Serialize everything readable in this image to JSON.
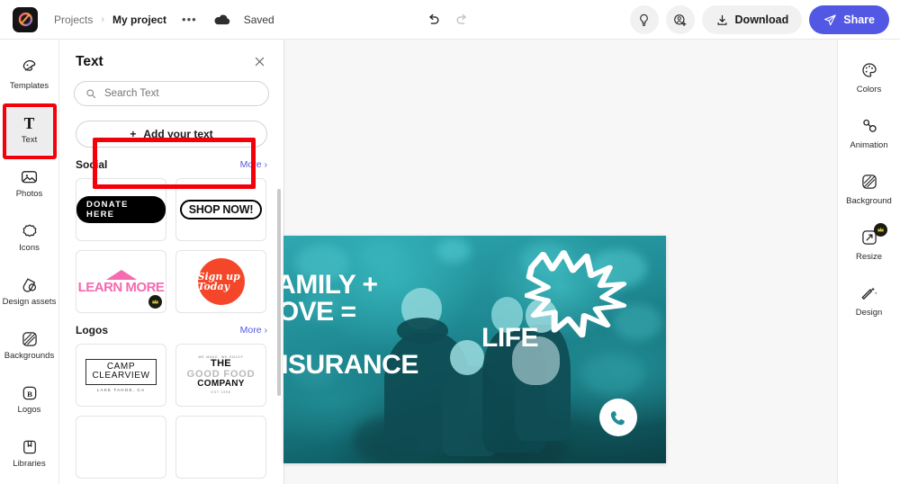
{
  "topbar": {
    "logo_icon": "adobe-express-logo-icon",
    "breadcrumb": {
      "projects": "Projects",
      "separator": "›",
      "current": "My project",
      "overflow": "•••"
    },
    "cloud_icon": "cloud-icon",
    "save_status": "Saved",
    "undo_icon": "undo-icon",
    "redo_icon": "redo-icon",
    "idea_icon": "lightbulb-icon",
    "add_collab_icon": "add-collaborator-icon",
    "download_icon": "download-icon",
    "download_label": "Download",
    "share_icon": "send-icon",
    "share_label": "Share"
  },
  "left_rail": {
    "items": [
      {
        "label": "Templates",
        "icon": "templates-icon",
        "active": false
      },
      {
        "label": "Text",
        "icon": "text-icon",
        "active": true
      },
      {
        "label": "Photos",
        "icon": "photos-icon",
        "active": false
      },
      {
        "label": "Icons",
        "icon": "icons-icon",
        "active": false
      },
      {
        "label": "Design assets",
        "icon": "design-assets-icon",
        "active": false
      },
      {
        "label": "Backgrounds",
        "icon": "backgrounds-icon",
        "active": false
      },
      {
        "label": "Logos",
        "icon": "logos-icon",
        "active": false
      },
      {
        "label": "Libraries",
        "icon": "libraries-icon",
        "active": false
      }
    ]
  },
  "panel": {
    "title": "Text",
    "close_icon": "close-icon",
    "search": {
      "icon": "search-icon",
      "placeholder": "Search Text",
      "value": ""
    },
    "add_text": {
      "plus": "+",
      "label": "Add your text"
    },
    "sections": [
      {
        "title": "Social",
        "more_label": "More ›",
        "cards": [
          {
            "name": "donate-here",
            "text": "DONATE  HERE",
            "premium": false
          },
          {
            "name": "shop-now",
            "text": "SHOP NOW!",
            "premium": false
          },
          {
            "name": "learn-more",
            "text": "LEARN MORE",
            "premium": true
          },
          {
            "name": "sign-up-today",
            "text": "Sign up Today",
            "premium": false
          }
        ]
      },
      {
        "title": "Logos",
        "more_label": "More ›",
        "cards": [
          {
            "name": "camp-clearview",
            "line1": "CAMP",
            "line2": "CLEARVIEW",
            "sub": "LAKE TAHOE, CA"
          },
          {
            "name": "the-good-food-company",
            "top": "WE MAKE, WE ENJOY",
            "the": "THE",
            "mid": "GOOD FOOD",
            "co": "COMPANY",
            "est": "EST 1998"
          }
        ]
      }
    ]
  },
  "canvas": {
    "hero_lines": [
      "FAMILY +",
      "LOVE =",
      "LIFE",
      "INSURANCE"
    ],
    "phone_icon": "phone-icon",
    "starburst_icon": "starburst-icon",
    "photo_alt": "family-photo-duotone"
  },
  "right_rail": {
    "items": [
      {
        "label": "Colors",
        "icon": "colors-icon",
        "premium": false
      },
      {
        "label": "Animation",
        "icon": "animation-icon",
        "premium": false
      },
      {
        "label": "Background",
        "icon": "background-icon",
        "premium": false
      },
      {
        "label": "Resize",
        "icon": "resize-icon",
        "premium": true
      },
      {
        "label": "Design",
        "icon": "design-wand-icon",
        "premium": false
      }
    ]
  },
  "highlights": {
    "rail_text_box": "red-highlight-text-tool",
    "add_text_box": "red-highlight-add-your-text"
  },
  "colors": {
    "accent_blue": "#5258e4",
    "highlight_red": "#f4000b",
    "canvas_teal": "#2fa8b0",
    "panel_bg": "#ffffff",
    "workspace_bg": "#f7f7f7"
  }
}
